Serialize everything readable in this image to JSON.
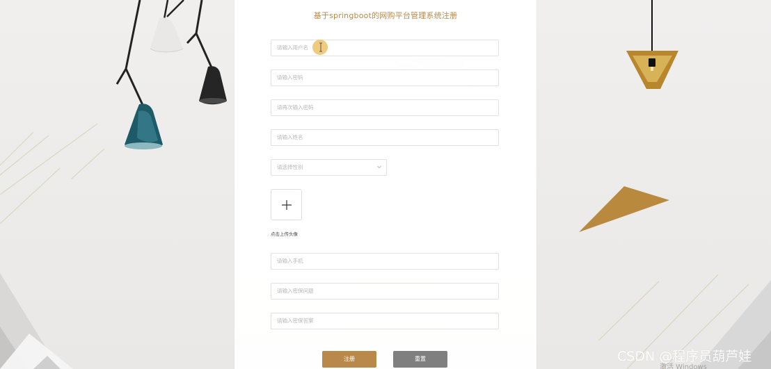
{
  "page": {
    "title": "基于springboot的网购平台管理系统注册"
  },
  "colors": {
    "accent": "#b8894a",
    "reset": "#7f7f7f",
    "placeholder": "#b7b7b7",
    "border": "#e2e2e2"
  },
  "form": {
    "fields": [
      {
        "placeholder": "请输入用户名"
      },
      {
        "placeholder": "请输入密码"
      },
      {
        "placeholder": "请再次输入密码"
      },
      {
        "placeholder": "请输入姓名"
      },
      {
        "placeholder": "请选择性别"
      },
      {
        "placeholder": "请输入手机"
      },
      {
        "placeholder": "请输入密保问题"
      },
      {
        "placeholder": "请输入密保答案"
      }
    ],
    "upload_label": "点击上传头像",
    "upload_icon": "plus-icon",
    "register_label": "注册",
    "reset_label": "重置"
  },
  "overlay": {
    "watermark": "CSDN @程序员葫芦娃",
    "activation": "激活 Windows"
  }
}
